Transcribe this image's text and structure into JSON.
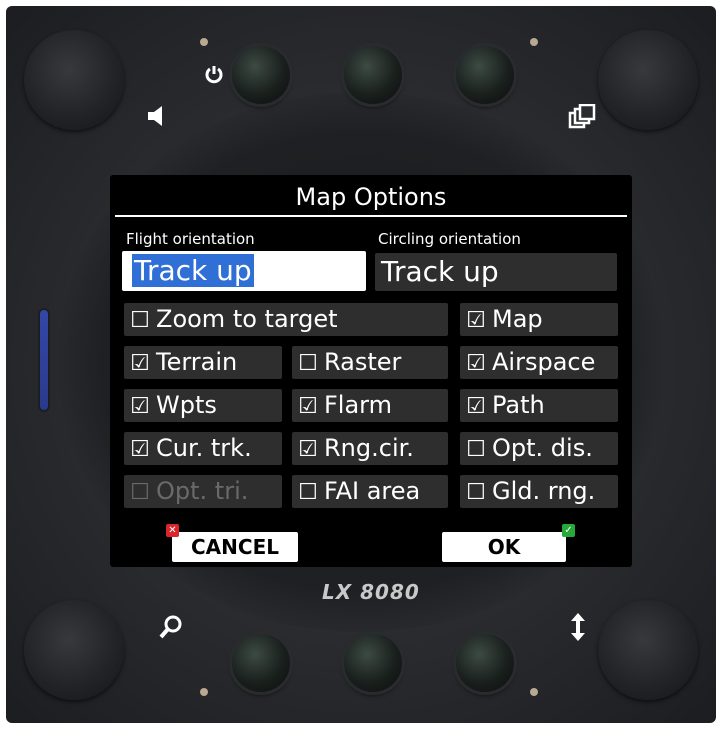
{
  "device": {
    "brand": "LX 8080",
    "rotary_level": 1.0
  },
  "dialog": {
    "title": "Map Options",
    "flight_orientation": {
      "label": "Flight orientation",
      "value": "Track up"
    },
    "circling_orientation": {
      "label": "Circling orientation",
      "value": "Track up"
    },
    "options": [
      {
        "label": "Zoom to target",
        "checked": false,
        "enabled": true,
        "mark": "☐"
      },
      {
        "label": "Map",
        "checked": true,
        "enabled": true,
        "mark": "☑"
      },
      {
        "label": "Terrain",
        "checked": true,
        "enabled": true,
        "mark": "☑"
      },
      {
        "label": "Raster",
        "checked": false,
        "enabled": true,
        "mark": "☐"
      },
      {
        "label": "Airspace",
        "checked": true,
        "enabled": true,
        "mark": "☑"
      },
      {
        "label": "Wpts",
        "checked": true,
        "enabled": true,
        "mark": "☑"
      },
      {
        "label": "Flarm",
        "checked": true,
        "enabled": true,
        "mark": "☑"
      },
      {
        "label": "Path",
        "checked": true,
        "enabled": true,
        "mark": "☑"
      },
      {
        "label": "Cur. trk.",
        "checked": true,
        "enabled": true,
        "mark": "☑"
      },
      {
        "label": "Rng.cir.",
        "checked": true,
        "enabled": true,
        "mark": "☑"
      },
      {
        "label": "Opt. dis.",
        "checked": false,
        "enabled": true,
        "mark": "☐"
      },
      {
        "label": "Opt. tri.",
        "checked": false,
        "enabled": false,
        "mark": "☐"
      },
      {
        "label": "FAI area",
        "checked": false,
        "enabled": true,
        "mark": "☐"
      },
      {
        "label": "Gld. rng.",
        "checked": false,
        "enabled": true,
        "mark": "☐"
      }
    ],
    "cancel_label": "CANCEL",
    "ok_label": "OK"
  },
  "icons": {
    "power": "power-icon",
    "sound": "speaker-icon",
    "pages": "pages-icon",
    "zoom": "magnifier-icon",
    "updown": "up-down-arrow-icon",
    "cancel": "cancel-x-icon",
    "ok": "ok-check-icon"
  },
  "colors": {
    "selection": "#2f6fd6",
    "cancel_badge": "#d9262b",
    "ok_badge": "#27a93a",
    "rotary_led": "#3447a8"
  }
}
